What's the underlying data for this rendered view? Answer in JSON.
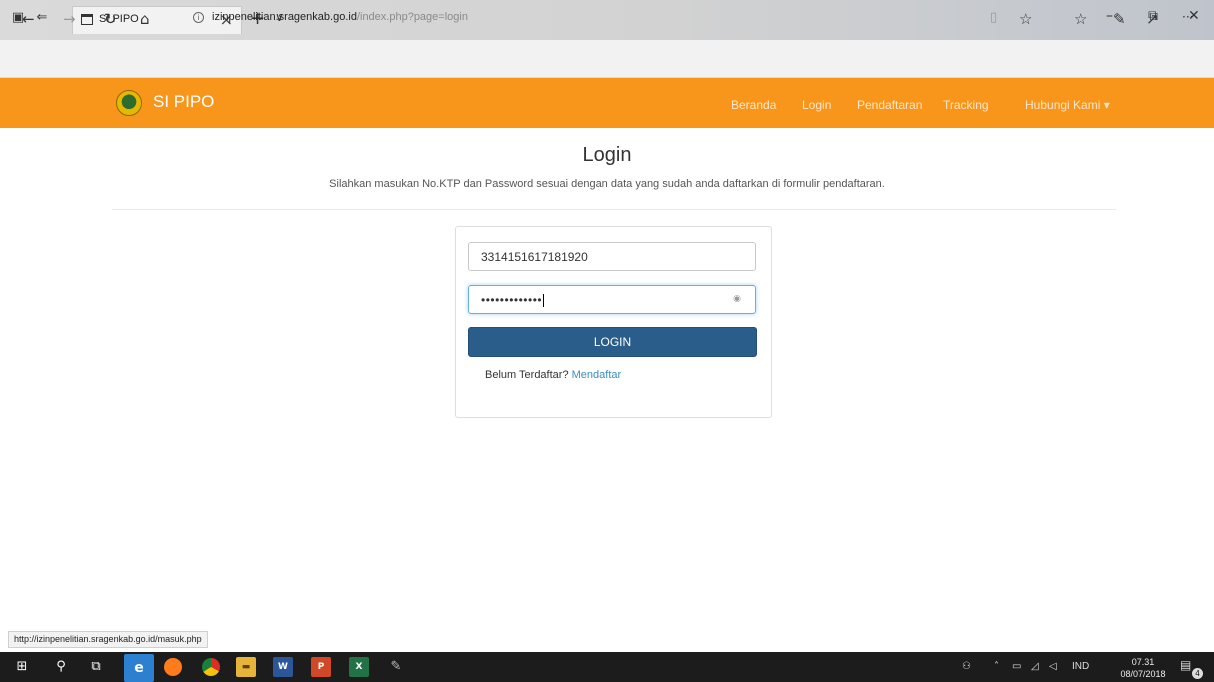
{
  "browser": {
    "tab_title": "SI PIPO",
    "tab_close": "×",
    "new_tab": "+",
    "tab_menu": "∨",
    "window_min": "–",
    "window_restore": "⧉",
    "window_close": "✕",
    "back": "←",
    "forward": "→",
    "refresh": "↻",
    "home": "⌂",
    "address_host": "izinpenelitian.sragenkab.go.id",
    "address_path": "/index.php?page=login",
    "reading_view": "▯",
    "favorite": "☆",
    "favorites_hub": "☆",
    "notes": "✎",
    "share": "↗",
    "more": "···",
    "status_url": "http://izinpenelitian.sragenkab.go.id/masuk.php"
  },
  "site": {
    "brand": "SI PIPO",
    "nav": [
      "Beranda",
      "Login",
      "Pendaftaran",
      "Tracking",
      "Hubungi Kami ▾"
    ]
  },
  "login": {
    "title": "Login",
    "subtitle": "Silahkan masukan No.KTP dan Password sesuai dengan data yang sudah anda daftarkan di formulir pendaftaran.",
    "ktp_value": "3314151617181920",
    "password_value": "•••••••••••••",
    "button": "LOGIN",
    "register_text": "Belum Terdaftar?",
    "register_link": "Mendaftar"
  },
  "taskbar": {
    "language": "IND",
    "time": "07.31",
    "date": "08/07/2018",
    "notifications": "4"
  },
  "colors": {
    "header": "#f7961b",
    "button": "#2a5d8a",
    "link": "#3c8dbc"
  }
}
